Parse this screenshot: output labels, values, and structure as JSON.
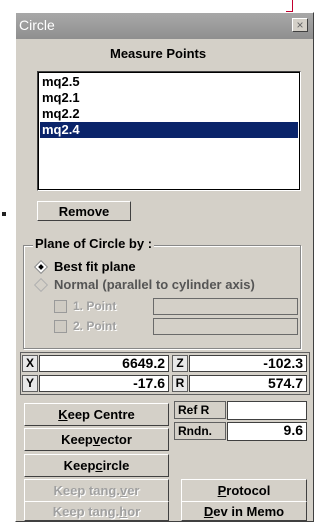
{
  "window": {
    "title": "Circle",
    "close_glyph": "×"
  },
  "measure_points": {
    "heading": "Measure Points",
    "items": [
      "mq2.5",
      "mq2.1",
      "mq2.2",
      "mq2.4"
    ],
    "selected_index": 3,
    "remove_label": "Remove"
  },
  "plane": {
    "group_title": "Plane of Circle by :",
    "options": [
      {
        "label": "Best fit plane",
        "selected": true
      },
      {
        "label": "Normal (parallel to cylinder axis)",
        "selected": false
      }
    ],
    "points": [
      {
        "label": "1. Point",
        "value": ""
      },
      {
        "label": "2. Point",
        "value": ""
      }
    ]
  },
  "coords": {
    "x_label": "X",
    "x_value": "6649.2",
    "y_label": "Y",
    "y_value": "-17.6",
    "z_label": "Z",
    "z_value": "-102.3",
    "r_label": "R",
    "r_value": "574.7"
  },
  "ref": {
    "ref_r_label": "Ref R",
    "ref_r_value": "",
    "rndn_label": "Rndn.",
    "rndn_value": "9.6"
  },
  "buttons": {
    "keep_centre": {
      "prefix": "",
      "mnemonic": "K",
      "rest": "eep Centre"
    },
    "keep_vector": {
      "prefix": "Keep ",
      "mnemonic": "v",
      "rest": "ector"
    },
    "keep_circle": {
      "prefix": "Keep ",
      "mnemonic": "c",
      "rest": "ircle"
    },
    "keep_tang_ver": {
      "prefix": "Keep tang. ",
      "mnemonic": "v",
      "rest": "er"
    },
    "keep_tang_hor": {
      "prefix": "Keep tang. ",
      "mnemonic": "h",
      "rest": "or"
    },
    "protocol": {
      "prefix": "",
      "mnemonic": "P",
      "rest": "rotocol"
    },
    "dev_in_memo": {
      "prefix": "",
      "mnemonic": "D",
      "rest": "ev in Memo"
    }
  }
}
